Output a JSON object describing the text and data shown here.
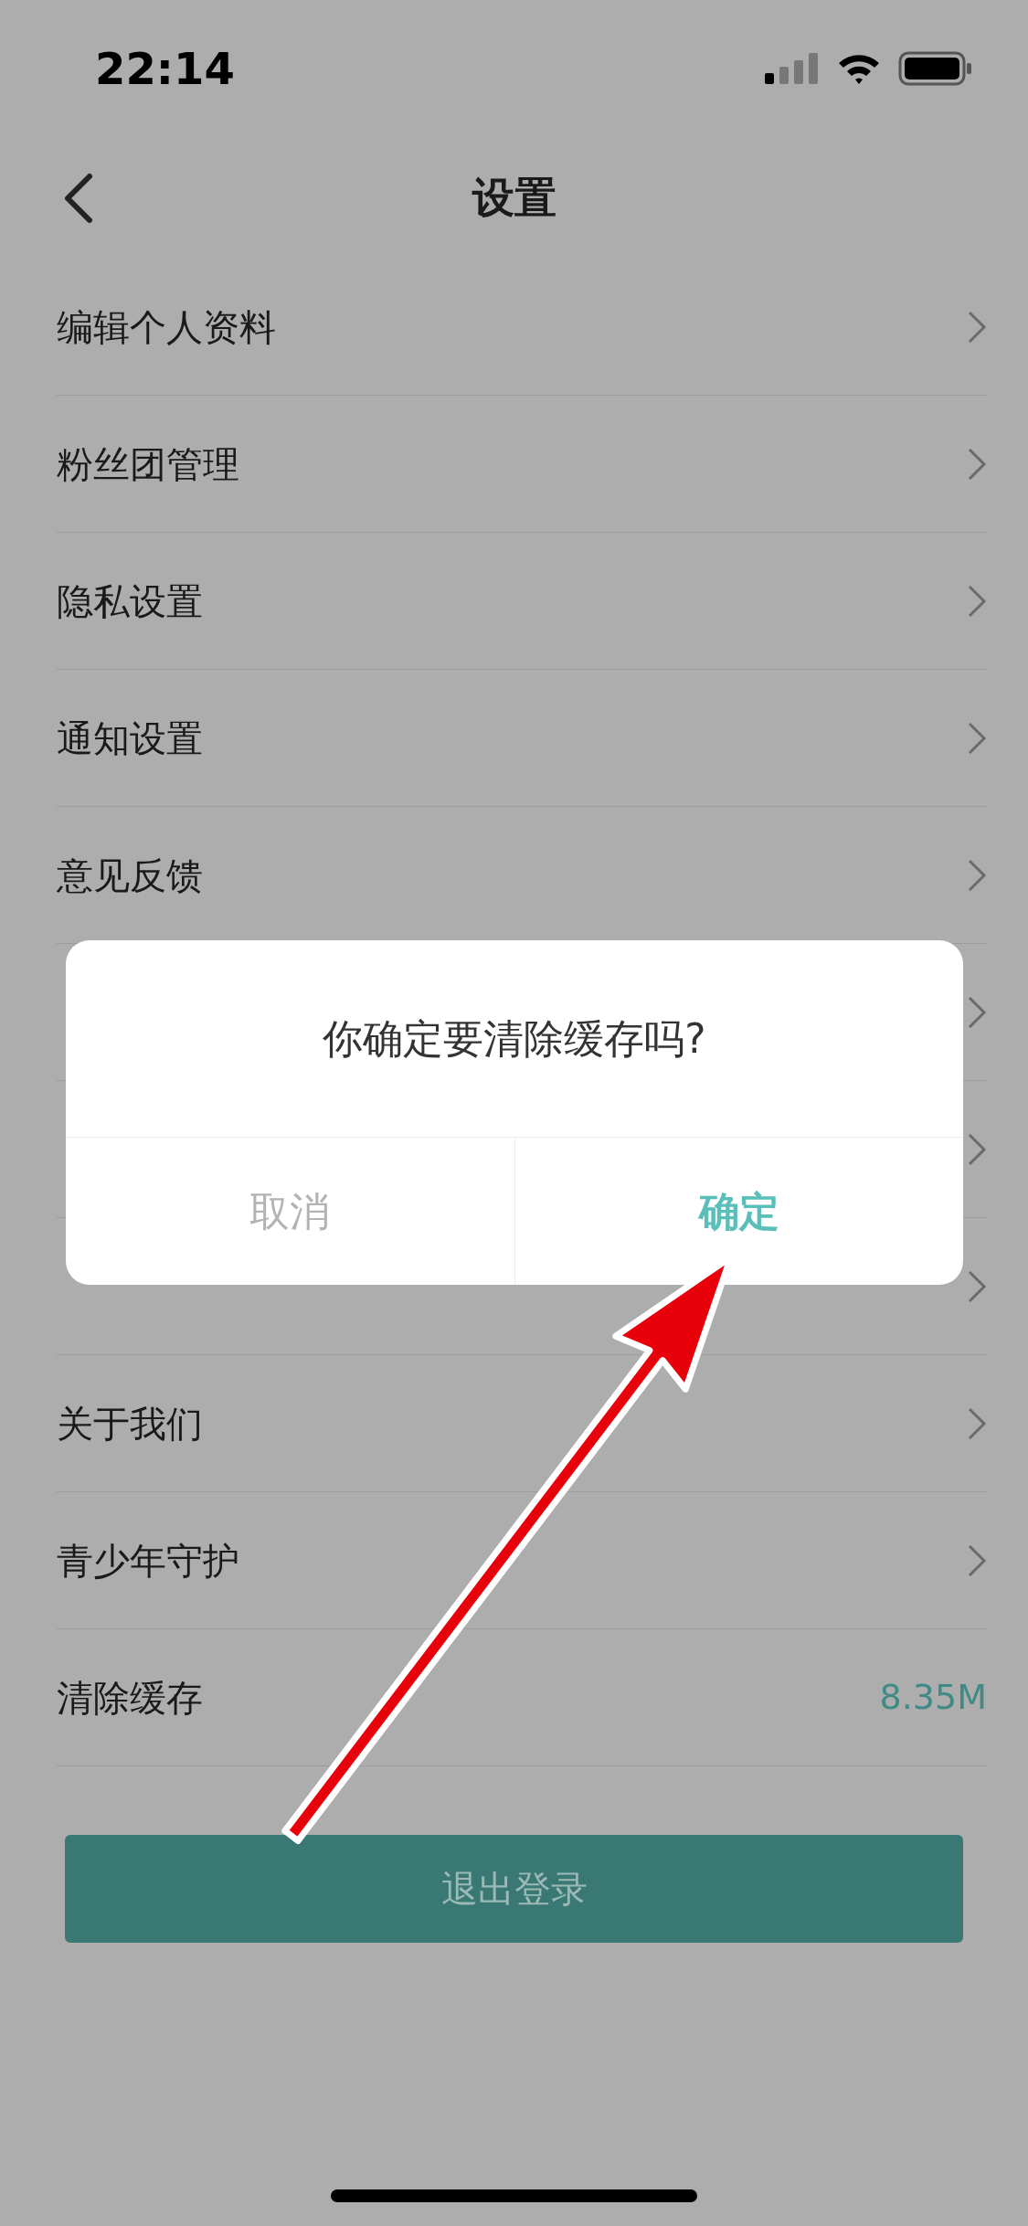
{
  "status_bar": {
    "time": "22:14"
  },
  "nav": {
    "title": "设置"
  },
  "rows": [
    {
      "kind": "link",
      "label": "编辑个人资料"
    },
    {
      "kind": "link",
      "label": "粉丝团管理"
    },
    {
      "kind": "link",
      "label": "隐私设置"
    },
    {
      "kind": "link",
      "label": "通知设置"
    },
    {
      "kind": "link",
      "label": "意见反馈"
    },
    {
      "kind": "link"
    },
    {
      "kind": "link"
    },
    {
      "kind": "link"
    },
    {
      "kind": "link",
      "label": "关于我们"
    },
    {
      "kind": "link",
      "label": "青少年守护"
    },
    {
      "kind": "value",
      "label": "清除缓存",
      "value": "8.35M"
    }
  ],
  "logout_button": "退出登录",
  "dialog": {
    "message": "你确定要清除缓存吗?",
    "buttons": [
      {
        "kind": "cancel",
        "label": "取消"
      },
      {
        "kind": "confirm",
        "label": "确定"
      }
    ]
  }
}
